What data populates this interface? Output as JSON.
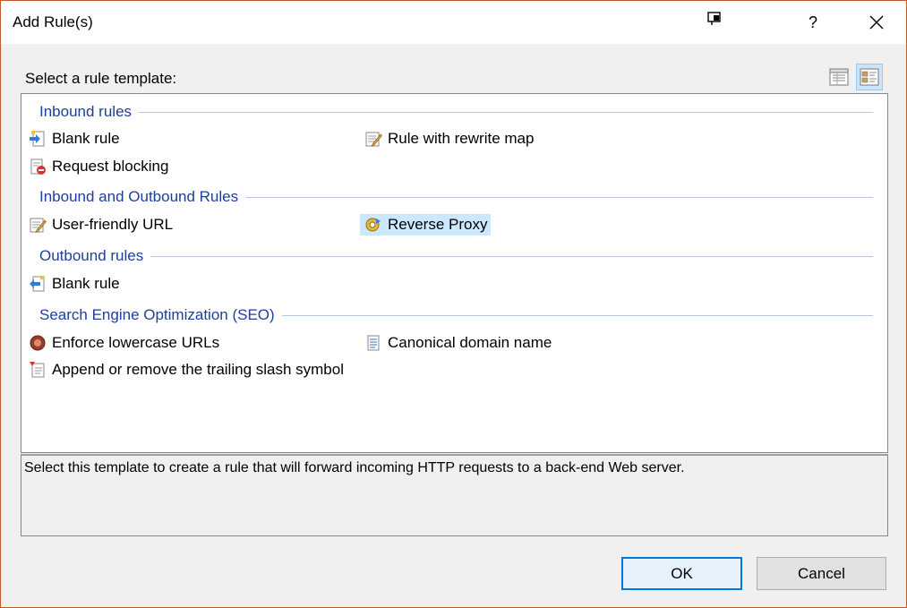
{
  "window": {
    "title": "Add Rule(s)",
    "help_glyph": "?",
    "close_glyph": "✕"
  },
  "prompt": "Select a rule template:",
  "view_buttons": [
    {
      "icon": "details-view-icon"
    },
    {
      "icon": "tiles-view-icon",
      "active": true
    }
  ],
  "groups": [
    {
      "label": "Inbound rules",
      "items": [
        {
          "label": "Blank rule",
          "icon": "blank-inbound-rule-icon"
        },
        {
          "label": "Rule with rewrite map",
          "icon": "rewrite-map-icon"
        },
        {
          "label": "Request blocking",
          "icon": "request-blocking-icon"
        }
      ]
    },
    {
      "label": "Inbound and Outbound Rules",
      "items": [
        {
          "label": "User-friendly URL",
          "icon": "user-friendly-url-icon"
        },
        {
          "label": "Reverse Proxy",
          "icon": "reverse-proxy-icon",
          "selected": true
        }
      ]
    },
    {
      "label": "Outbound rules",
      "items": [
        {
          "label": "Blank rule",
          "icon": "blank-outbound-rule-icon"
        }
      ]
    },
    {
      "label": "Search Engine Optimization (SEO)",
      "items": [
        {
          "label": "Enforce lowercase URLs",
          "icon": "lowercase-url-icon"
        },
        {
          "label": "Canonical domain name",
          "icon": "canonical-domain-icon"
        },
        {
          "label": "Append or remove the trailing slash symbol",
          "icon": "trailing-slash-icon"
        }
      ]
    }
  ],
  "description": "Select this template to create a rule that will forward incoming HTTP requests to a back-end Web server.",
  "buttons": {
    "ok": "OK",
    "cancel": "Cancel"
  },
  "colors": {
    "group_header": "#1e3f9a",
    "selection": "#cce8ff",
    "window_border": "#c4582c",
    "default_button_border": "#0078d7"
  }
}
